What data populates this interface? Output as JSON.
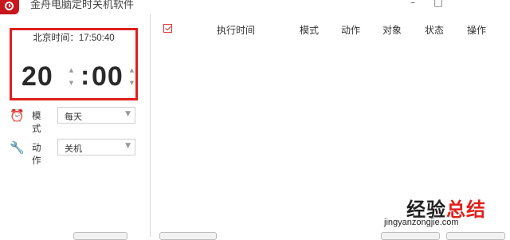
{
  "window": {
    "title": "金舟电脑定时关机软件",
    "minimize": "–",
    "maximize": "□"
  },
  "clock": {
    "beijing_label": "北京时间：17:50:40",
    "hour": "20",
    "minute": "00"
  },
  "settings": {
    "mode_label": "模式",
    "mode_value": "每天",
    "action_label": "动作",
    "action_value": "关机"
  },
  "table": {
    "columns": [
      "执行时间",
      "模式",
      "动作",
      "对象",
      "状态",
      "操作"
    ],
    "rows": []
  },
  "watermark": {
    "part1": "经验",
    "part2": "总结",
    "url": "jingyanzongjie.com"
  },
  "colors": {
    "accent_red": "#e0201c",
    "brand_red": "#c8161d"
  }
}
